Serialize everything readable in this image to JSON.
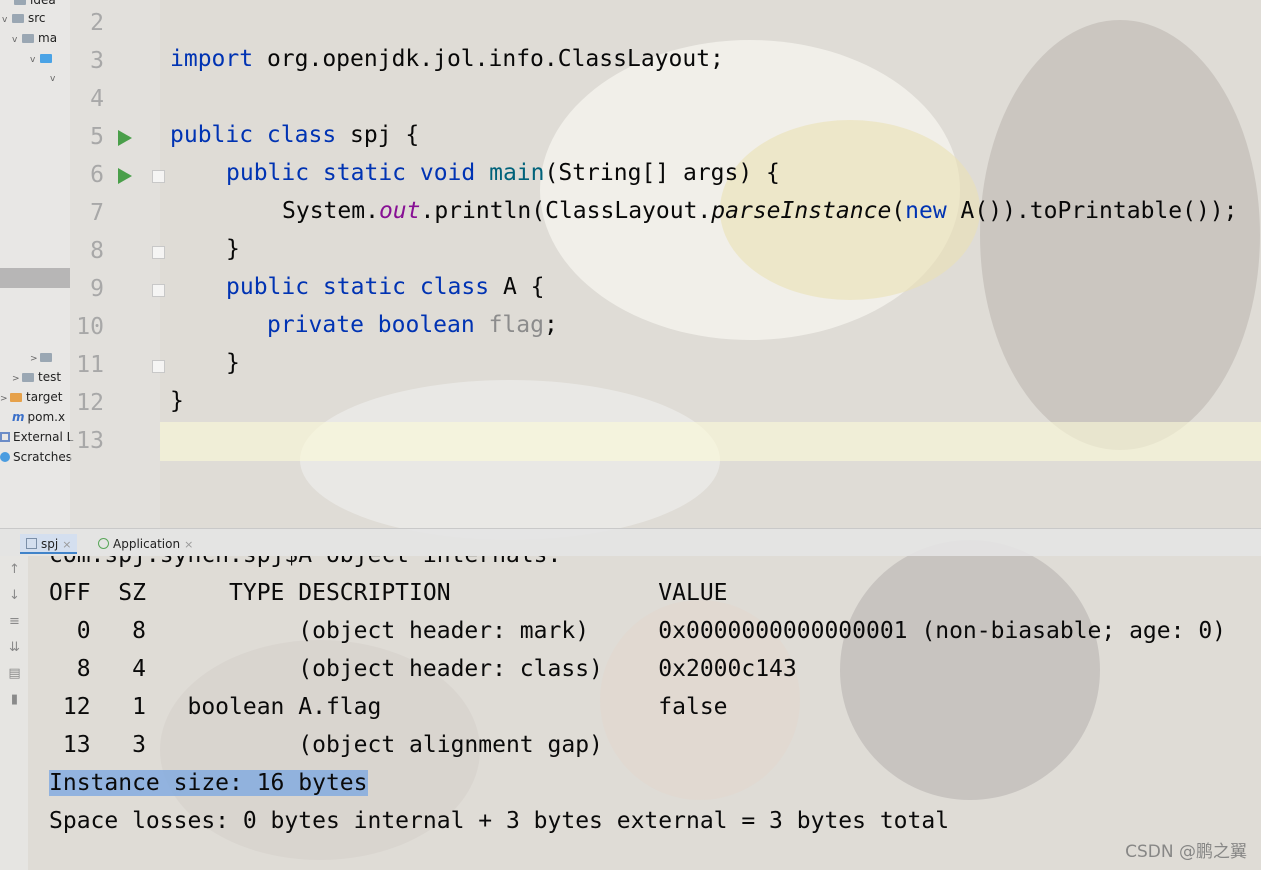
{
  "project_tree": {
    "items": [
      {
        "label": "idea",
        "icon": "folder-icon"
      },
      {
        "label": "src",
        "icon": "folder-icon"
      },
      {
        "label": "ma",
        "icon": "folder-icon"
      },
      {
        "label": "",
        "icon": "folder-icon"
      },
      {
        "label": "",
        "icon": "folder-icon"
      },
      {
        "label": "",
        "icon": "folder-icon"
      },
      {
        "label": "test",
        "icon": "folder-icon"
      },
      {
        "label": "target",
        "icon": "folder-icon"
      },
      {
        "label": "pom.x",
        "icon": "maven-icon"
      },
      {
        "label": "External L",
        "icon": "library-icon"
      },
      {
        "label": "Scratches",
        "icon": "scratch-icon"
      }
    ]
  },
  "editor": {
    "line_numbers": [
      "2",
      "3",
      "4",
      "5",
      "6",
      "7",
      "8",
      "9",
      "10",
      "11",
      "12",
      "13"
    ],
    "lines": {
      "l3_kw": "import",
      "l3_rest": " org.openjdk.jol.info.ClassLayout;",
      "l5_kw": "public class",
      "l5_rest": " spj {",
      "l6_kw": "public static void",
      "l6_fn": "main",
      "l6_rest": "(String[] args) {",
      "l7_a": "System.",
      "l7_out": "out",
      "l7_b": ".println(ClassLayout.",
      "l7_parse": "parseInstance",
      "l7_c": "(",
      "l7_new": "new",
      "l7_d": " A()).toPrintable());",
      "l8": "}",
      "l9_kw": "public static class",
      "l9_rest": " A {",
      "l10_kw": "private boolean",
      "l10_field": "flag",
      "l10_rest": ";",
      "l11": "}",
      "l12": "}"
    }
  },
  "run_tabs": [
    {
      "label": "spj",
      "active": true
    },
    {
      "label": "Application",
      "active": false
    }
  ],
  "console": {
    "clipped_header": "com.spj.synch.spj$A object internals:",
    "header": "OFF  SZ      TYPE DESCRIPTION               VALUE",
    "rows": [
      "  0   8           (object header: mark)     0x0000000000000001 (non-biasable; age: 0)",
      "  8   4           (object header: class)    0x2000c143",
      " 12   1   boolean A.flag                    false",
      " 13   3           (object alignment gap)"
    ],
    "instance_size": "Instance size: 16 bytes",
    "space_losses": "Space losses: 0 bytes internal + 3 bytes external = 3 bytes total"
  },
  "watermark": "CSDN @鹏之翼",
  "colors": {
    "keyword": "#0033b3",
    "method": "#00627a",
    "static_field": "#871094",
    "selection": "#78a5e1",
    "run_icon": "#4a9f4a"
  }
}
